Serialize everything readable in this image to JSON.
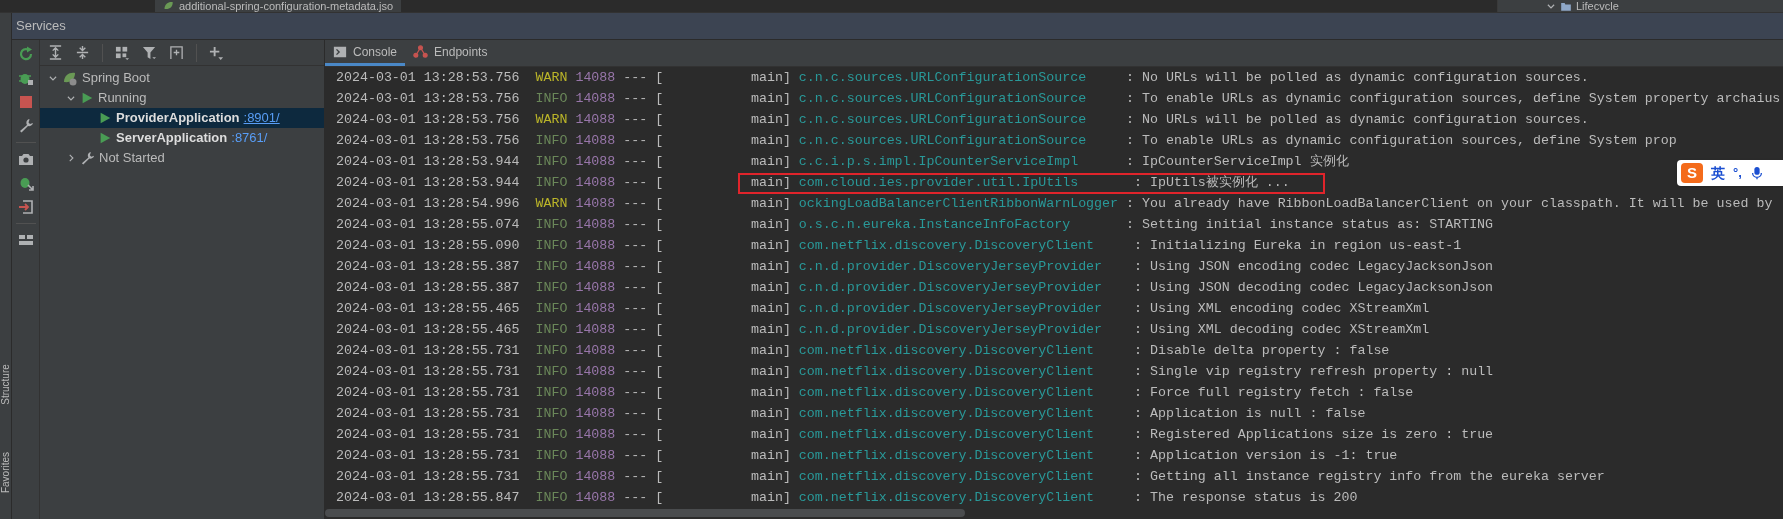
{
  "editor_tabs": [
    {
      "label": "additional-spring-configuration-metadata.jso"
    }
  ],
  "right_panel": {
    "label": "Lifecvcle",
    "expanded": true
  },
  "side_stripe": [
    {
      "label": "Structure"
    },
    {
      "label": "Favorites"
    }
  ],
  "tool_window": {
    "title": "Services"
  },
  "tree": [
    {
      "label": "Spring Boot",
      "expanded": true,
      "selected": false,
      "children": [
        {
          "label": "Running",
          "expanded": true,
          "selected": false,
          "children": [
            {
              "label": "ProviderApplication",
              "port": ":8901/",
              "selected": true
            },
            {
              "label": "ServerApplication",
              "port": ":8761/",
              "selected": false
            }
          ]
        },
        {
          "label": "Not Started",
          "expanded": false,
          "selected": false
        }
      ]
    }
  ],
  "console_tabs": [
    {
      "label": "Console",
      "selected": true
    },
    {
      "label": "Endpoints",
      "selected": false
    }
  ],
  "log": [
    {
      "time": "2024-03-01 13:28:53.756",
      "kind": "warn",
      "level": " WARN",
      "pid": "14088",
      "thread": "--- [           main]",
      "logger": "c.n.c.sources.URLConfigurationSource    ",
      "message": " : No URLs will be polled as dynamic configuration sources.",
      "highlighted": false
    },
    {
      "time": "2024-03-01 13:28:53.756",
      "kind": "info",
      "level": " INFO",
      "pid": "14088",
      "thread": "--- [           main]",
      "logger": "c.n.c.sources.URLConfigurationSource    ",
      "message": " : To enable URLs as dynamic configuration sources, define System property archaius",
      "highlighted": false
    },
    {
      "time": "2024-03-01 13:28:53.756",
      "kind": "warn",
      "level": " WARN",
      "pid": "14088",
      "thread": "--- [           main]",
      "logger": "c.n.c.sources.URLConfigurationSource    ",
      "message": " : No URLs will be polled as dynamic configuration sources.",
      "highlighted": false
    },
    {
      "time": "2024-03-01 13:28:53.756",
      "kind": "info",
      "level": " INFO",
      "pid": "14088",
      "thread": "--- [           main]",
      "logger": "c.n.c.sources.URLConfigurationSource    ",
      "message": " : To enable URLs as dynamic configuration sources, define System prop",
      "highlighted": false
    },
    {
      "time": "2024-03-01 13:28:53.944",
      "kind": "info",
      "level": " INFO",
      "pid": "14088",
      "thread": "--- [           main]",
      "logger": "c.c.i.p.s.impl.IpCounterServiceImpl     ",
      "message": " : IpCounterServiceImpl 实例化",
      "highlighted": false
    },
    {
      "time": "2024-03-01 13:28:53.944",
      "kind": "info",
      "level": " INFO",
      "pid": "14088",
      "thread": "--- [           main]",
      "logger": "com.cloud.ies.provider.util.IpUtils      ",
      "message": " : IpUtils被实例化 ...",
      "highlighted": true
    },
    {
      "time": "2024-03-01 13:28:54.996",
      "kind": "warn",
      "level": " WARN",
      "pid": "14088",
      "thread": "--- [           main]",
      "logger": "ockingLoadBalancerClientRibbonWarnLogger",
      "message": " : You already have RibbonLoadBalancerClient on your classpath. It will be used by",
      "highlighted": false
    },
    {
      "time": "2024-03-01 13:28:55.074",
      "kind": "info",
      "level": " INFO",
      "pid": "14088",
      "thread": "--- [           main]",
      "logger": "o.s.c.n.eureka.InstanceInfoFactory      ",
      "message": " : Setting initial instance status as: STARTING",
      "highlighted": false
    },
    {
      "time": "2024-03-01 13:28:55.090",
      "kind": "info",
      "level": " INFO",
      "pid": "14088",
      "thread": "--- [           main]",
      "logger": "com.netflix.discovery.DiscoveryClient    ",
      "message": " : Initializing Eureka in region us-east-1",
      "highlighted": false
    },
    {
      "time": "2024-03-01 13:28:55.387",
      "kind": "info",
      "level": " INFO",
      "pid": "14088",
      "thread": "--- [           main]",
      "logger": "c.n.d.provider.DiscoveryJerseyProvider   ",
      "message": " : Using JSON encoding codec LegacyJacksonJson",
      "highlighted": false
    },
    {
      "time": "2024-03-01 13:28:55.387",
      "kind": "info",
      "level": " INFO",
      "pid": "14088",
      "thread": "--- [           main]",
      "logger": "c.n.d.provider.DiscoveryJerseyProvider   ",
      "message": " : Using JSON decoding codec LegacyJacksonJson",
      "highlighted": false
    },
    {
      "time": "2024-03-01 13:28:55.465",
      "kind": "info",
      "level": " INFO",
      "pid": "14088",
      "thread": "--- [           main]",
      "logger": "c.n.d.provider.DiscoveryJerseyProvider   ",
      "message": " : Using XML encoding codec XStreamXml",
      "highlighted": false
    },
    {
      "time": "2024-03-01 13:28:55.465",
      "kind": "info",
      "level": " INFO",
      "pid": "14088",
      "thread": "--- [           main]",
      "logger": "c.n.d.provider.DiscoveryJerseyProvider   ",
      "message": " : Using XML decoding codec XStreamXml",
      "highlighted": false
    },
    {
      "time": "2024-03-01 13:28:55.731",
      "kind": "info",
      "level": " INFO",
      "pid": "14088",
      "thread": "--- [           main]",
      "logger": "com.netflix.discovery.DiscoveryClient    ",
      "message": " : Disable delta property : false",
      "highlighted": false
    },
    {
      "time": "2024-03-01 13:28:55.731",
      "kind": "info",
      "level": " INFO",
      "pid": "14088",
      "thread": "--- [           main]",
      "logger": "com.netflix.discovery.DiscoveryClient    ",
      "message": " : Single vip registry refresh property : null",
      "highlighted": false
    },
    {
      "time": "2024-03-01 13:28:55.731",
      "kind": "info",
      "level": " INFO",
      "pid": "14088",
      "thread": "--- [           main]",
      "logger": "com.netflix.discovery.DiscoveryClient    ",
      "message": " : Force full registry fetch : false",
      "highlighted": false
    },
    {
      "time": "2024-03-01 13:28:55.731",
      "kind": "info",
      "level": " INFO",
      "pid": "14088",
      "thread": "--- [           main]",
      "logger": "com.netflix.discovery.DiscoveryClient    ",
      "message": " : Application is null : false",
      "highlighted": false
    },
    {
      "time": "2024-03-01 13:28:55.731",
      "kind": "info",
      "level": " INFO",
      "pid": "14088",
      "thread": "--- [           main]",
      "logger": "com.netflix.discovery.DiscoveryClient    ",
      "message": " : Registered Applications size is zero : true",
      "highlighted": false
    },
    {
      "time": "2024-03-01 13:28:55.731",
      "kind": "info",
      "level": " INFO",
      "pid": "14088",
      "thread": "--- [           main]",
      "logger": "com.netflix.discovery.DiscoveryClient    ",
      "message": " : Application version is -1: true",
      "highlighted": false
    },
    {
      "time": "2024-03-01 13:28:55.731",
      "kind": "info",
      "level": " INFO",
      "pid": "14088",
      "thread": "--- [           main]",
      "logger": "com.netflix.discovery.DiscoveryClient    ",
      "message": " : Getting all instance registry info from the eureka server",
      "highlighted": false
    },
    {
      "time": "2024-03-01 13:28:55.847",
      "kind": "info",
      "level": " INFO",
      "pid": "14088",
      "thread": "--- [           main]",
      "logger": "com.netflix.discovery.DiscoveryClient    ",
      "message": " : The response status is 200",
      "highlighted": false
    }
  ],
  "ime_toolbar": {
    "logo": "S",
    "mode": "英",
    "punctuation": "°,"
  }
}
